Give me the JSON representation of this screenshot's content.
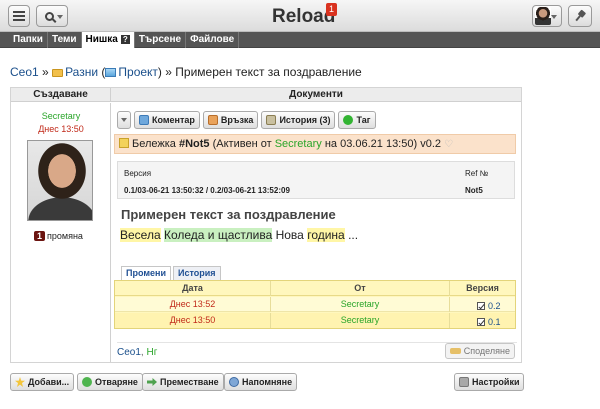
{
  "header": {
    "app_title": "Reload",
    "notification_count": "1"
  },
  "tabs": [
    {
      "label": "Папки"
    },
    {
      "label": "Теми"
    },
    {
      "label": "Нишка",
      "active": true,
      "help": "?"
    },
    {
      "label": "Търсене"
    },
    {
      "label": "Файлове"
    }
  ],
  "breadcrumb": {
    "root": "Ceo1",
    "sep1": "»",
    "folder": "Разни",
    "open_paren": "(",
    "project": "Проект",
    "close_paren": ")",
    "sep2": "»",
    "current": "Примерен текст за поздравление"
  },
  "panel": {
    "left_header": "Създаване",
    "right_header": "Документи",
    "author_role": "Secretary",
    "author_date": "Днес 13:50",
    "changes_count": "1",
    "changes_label": "промяна"
  },
  "toolbar": {
    "comment": "Коментар",
    "link": "Връзка",
    "history": "История (3)",
    "tag": "Таг"
  },
  "note": {
    "prefix": "Бележка",
    "id": "#Not5",
    "active_from": "(Активен от",
    "user": "Secretary",
    "on_date": "на 03.06.21 13:50)",
    "version": "v0.2"
  },
  "version_table": {
    "col_version": "Версия",
    "col_ref": "Ref №",
    "version_value": "0.1/03-06-21 13:50:32 / 0.2/03-06-21 13:52:09",
    "ref_value": "Not5"
  },
  "document": {
    "title": "Примерен текст за поздравление",
    "w1": "Весела",
    "w2": "Коледа и щастлива",
    "w3": "Нова",
    "w4": "година",
    "w5": "..."
  },
  "subtabs": {
    "changes": "Промени",
    "history": "История"
  },
  "history_table": {
    "col_date": "Дата",
    "col_from": "От",
    "col_version": "Версия",
    "rows": [
      {
        "date": "Днес 13:52",
        "from": "Secretary",
        "version": "0.2"
      },
      {
        "date": "Днес 13:50",
        "from": "Secretary",
        "version": "0.1"
      }
    ]
  },
  "footer": {
    "tag1": "Ceo1",
    "tag_sep": ",",
    "tag2": "Нг",
    "share": "Споделяне"
  },
  "bottom": {
    "add": "Добави...",
    "open": "Отваряне",
    "move": "Преместване",
    "remind": "Напомняне",
    "settings": "Настройки"
  }
}
